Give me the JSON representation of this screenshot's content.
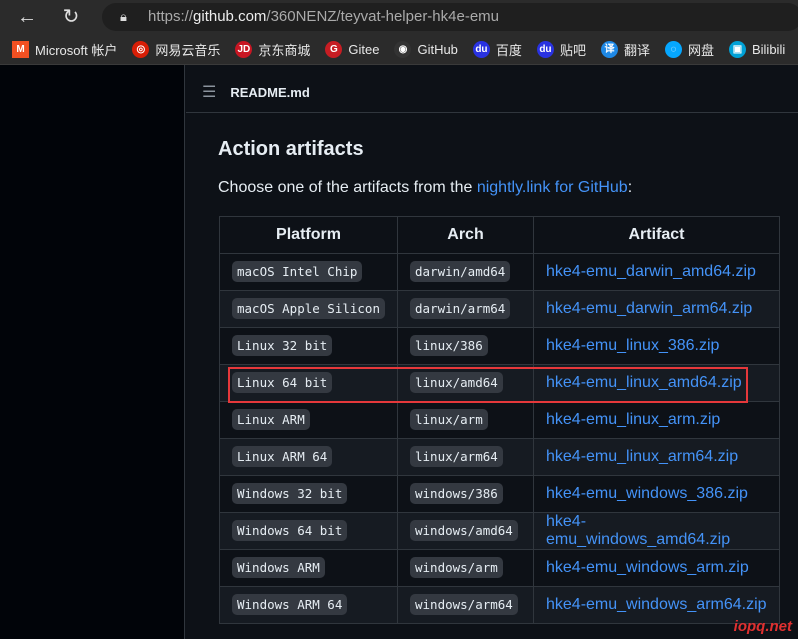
{
  "browser": {
    "url_prefix": "https://",
    "url_domain": "github.com",
    "url_path": "/360NENZ/teyvat-helper-hk4e-emu",
    "bookmarks": [
      {
        "label": "Microsoft 帐户",
        "color": "#f25022",
        "icon": "M"
      },
      {
        "label": "网易云音乐",
        "color": "#d81e06",
        "icon": "◎"
      },
      {
        "label": "京东商城",
        "color": "#c81623",
        "icon": "JD"
      },
      {
        "label": "Gitee",
        "color": "#c71d23",
        "icon": "G"
      },
      {
        "label": "GitHub",
        "color": "#333333",
        "icon": "◉"
      },
      {
        "label": "百度",
        "color": "#2932e1",
        "icon": "du"
      },
      {
        "label": "贴吧",
        "color": "#2932e1",
        "icon": "du"
      },
      {
        "label": "翻译",
        "color": "#1e88e5",
        "icon": "译"
      },
      {
        "label": "网盘",
        "color": "#06a7ff",
        "icon": "◌"
      },
      {
        "label": "Bilibili",
        "color": "#00a1d6",
        "icon": "▣"
      }
    ]
  },
  "readme": {
    "filename": "README.md"
  },
  "section": {
    "title": "Action artifacts",
    "intro_before": "Choose one of the artifacts from the ",
    "intro_link": "nightly.link for GitHub",
    "intro_after": ":"
  },
  "table": {
    "headers": [
      "Platform",
      "Arch",
      "Artifact"
    ],
    "rows": [
      [
        "macOS Intel Chip",
        "darwin/amd64",
        "hke4-emu_darwin_amd64.zip"
      ],
      [
        "macOS Apple Silicon",
        "darwin/arm64",
        "hke4-emu_darwin_arm64.zip"
      ],
      [
        "Linux 32 bit",
        "linux/386",
        "hke4-emu_linux_386.zip"
      ],
      [
        "Linux 64 bit",
        "linux/amd64",
        "hke4-emu_linux_amd64.zip"
      ],
      [
        "Linux ARM",
        "linux/arm",
        "hke4-emu_linux_arm.zip"
      ],
      [
        "Linux ARM 64",
        "linux/arm64",
        "hke4-emu_linux_arm64.zip"
      ],
      [
        "Windows 32 bit",
        "windows/386",
        "hke4-emu_windows_386.zip"
      ],
      [
        "Windows 64 bit",
        "windows/amd64",
        "hke4-emu_windows_amd64.zip"
      ],
      [
        "Windows ARM",
        "windows/arm",
        "hke4-emu_windows_arm.zip"
      ],
      [
        "Windows ARM 64",
        "windows/arm64",
        "hke4-emu_windows_arm64.zip"
      ]
    ],
    "highlighted_row": 3
  },
  "watermark": "iopq.net"
}
